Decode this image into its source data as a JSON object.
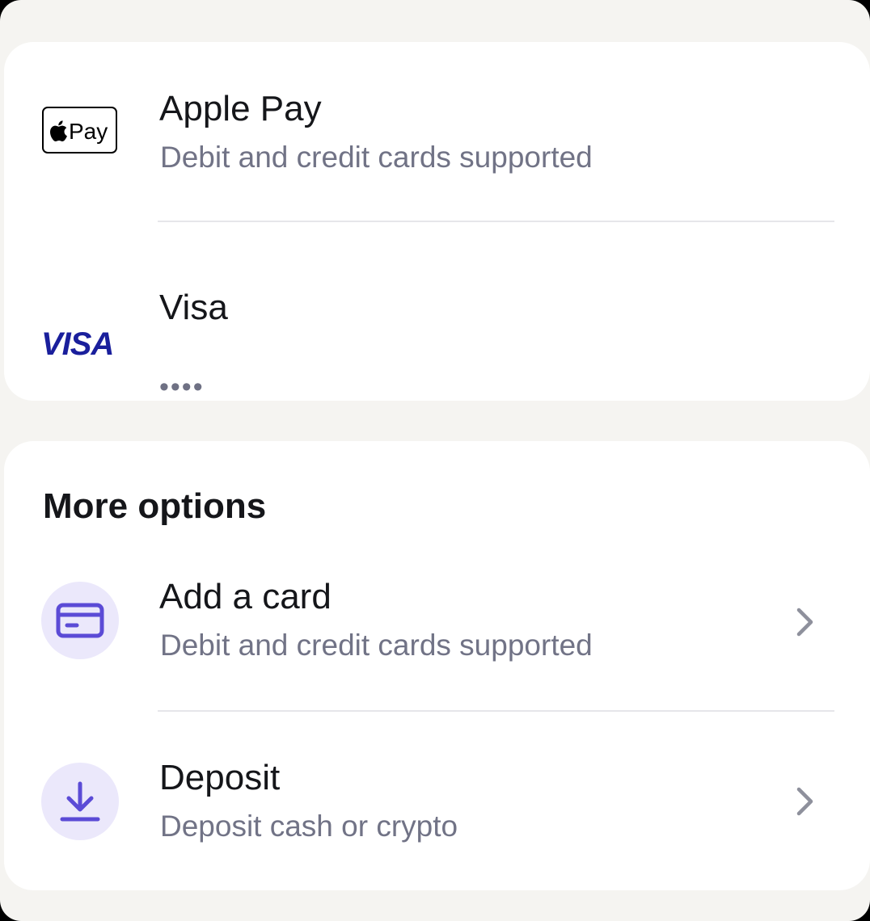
{
  "payment_methods": {
    "apple_pay": {
      "logo_text": "Pay",
      "title": "Apple Pay",
      "subtitle": "Debit and credit cards supported"
    },
    "visa": {
      "logo_text": "VISA",
      "title": "Visa",
      "masked_number": "••••"
    }
  },
  "more_options": {
    "heading": "More options",
    "items": [
      {
        "title": "Add a card",
        "subtitle": "Debit and credit cards supported",
        "icon": "card-icon"
      },
      {
        "title": "Deposit",
        "subtitle": "Deposit cash or crypto",
        "icon": "download-icon"
      }
    ]
  },
  "colors": {
    "accent": "#5b4bd6",
    "icon_background": "#ebe8fb",
    "visa_blue": "#1a1f9c",
    "secondary_text": "#717386"
  }
}
